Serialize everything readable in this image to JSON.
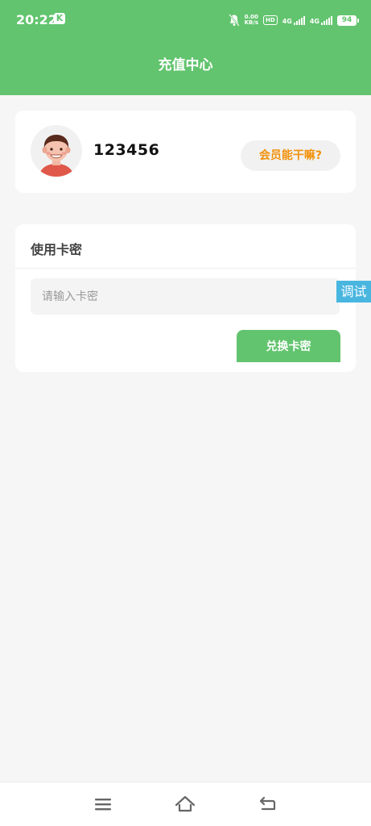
{
  "status_bar": {
    "time": "20:22",
    "app_badge": "K",
    "speed_value": "0.00",
    "speed_unit": "KB/s",
    "hd_label": "HD",
    "sim1_label": "4G",
    "sim2_label": "4G",
    "battery": "94"
  },
  "header": {
    "title": "充值中心"
  },
  "profile": {
    "username": "123456",
    "vip_button_label": "会员能干嘛?"
  },
  "card_section": {
    "title": "使用卡密",
    "input_placeholder": "请输入卡密",
    "input_value": "",
    "redeem_button_label": "兑换卡密"
  },
  "debug_tag": "调试",
  "nav_bar": {
    "icons": [
      "menu-icon",
      "home-icon",
      "back-icon"
    ]
  },
  "colors": {
    "primary": "#62c46e",
    "accent": "#f2920c",
    "debug": "#49b6e0",
    "background": "#f6f6f6"
  }
}
